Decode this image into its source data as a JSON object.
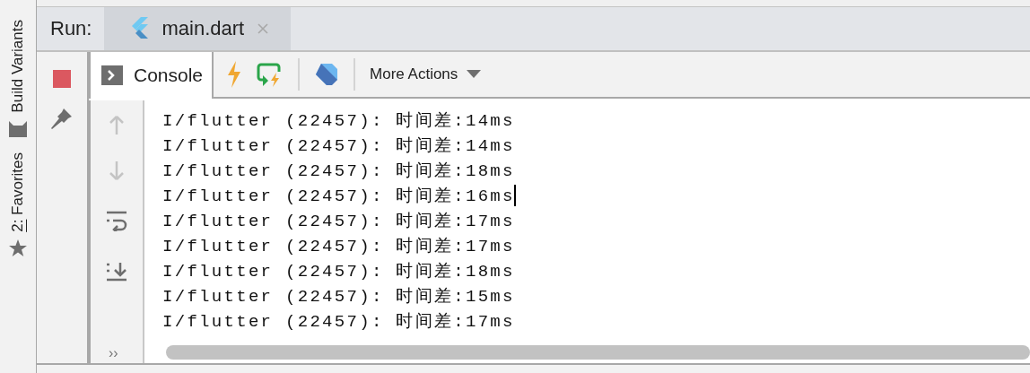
{
  "side_strip": {
    "items": [
      {
        "label": "Build Variants",
        "kind": "build"
      },
      {
        "label": "2: Favorites",
        "kind": "favorites"
      }
    ]
  },
  "run_bar": {
    "title": "Run:",
    "tabs": [
      {
        "label": "main.dart",
        "selected": true
      }
    ]
  },
  "toolbar": {
    "console_tab": {
      "label": "Console",
      "selected": true
    },
    "more_actions": "More Actions"
  },
  "console": {
    "lines": [
      {
        "text": "I/flutter (22457): 时间差:14ms",
        "has_caret": false
      },
      {
        "text": "I/flutter (22457): 时间差:14ms",
        "has_caret": false
      },
      {
        "text": "I/flutter (22457): 时间差:18ms",
        "has_caret": false
      },
      {
        "text": "I/flutter (22457): 时间差:16ms",
        "has_caret": true
      },
      {
        "text": "I/flutter (22457): 时间差:17ms",
        "has_caret": false
      },
      {
        "text": "I/flutter (22457): 时间差:17ms",
        "has_caret": false
      },
      {
        "text": "I/flutter (22457): 时间差:18ms",
        "has_caret": false
      },
      {
        "text": "I/flutter (22457): 时间差:15ms",
        "has_caret": false
      },
      {
        "text": "I/flutter (22457): 时间差:17ms",
        "has_caret": false
      }
    ],
    "gutter_more": "››"
  }
}
